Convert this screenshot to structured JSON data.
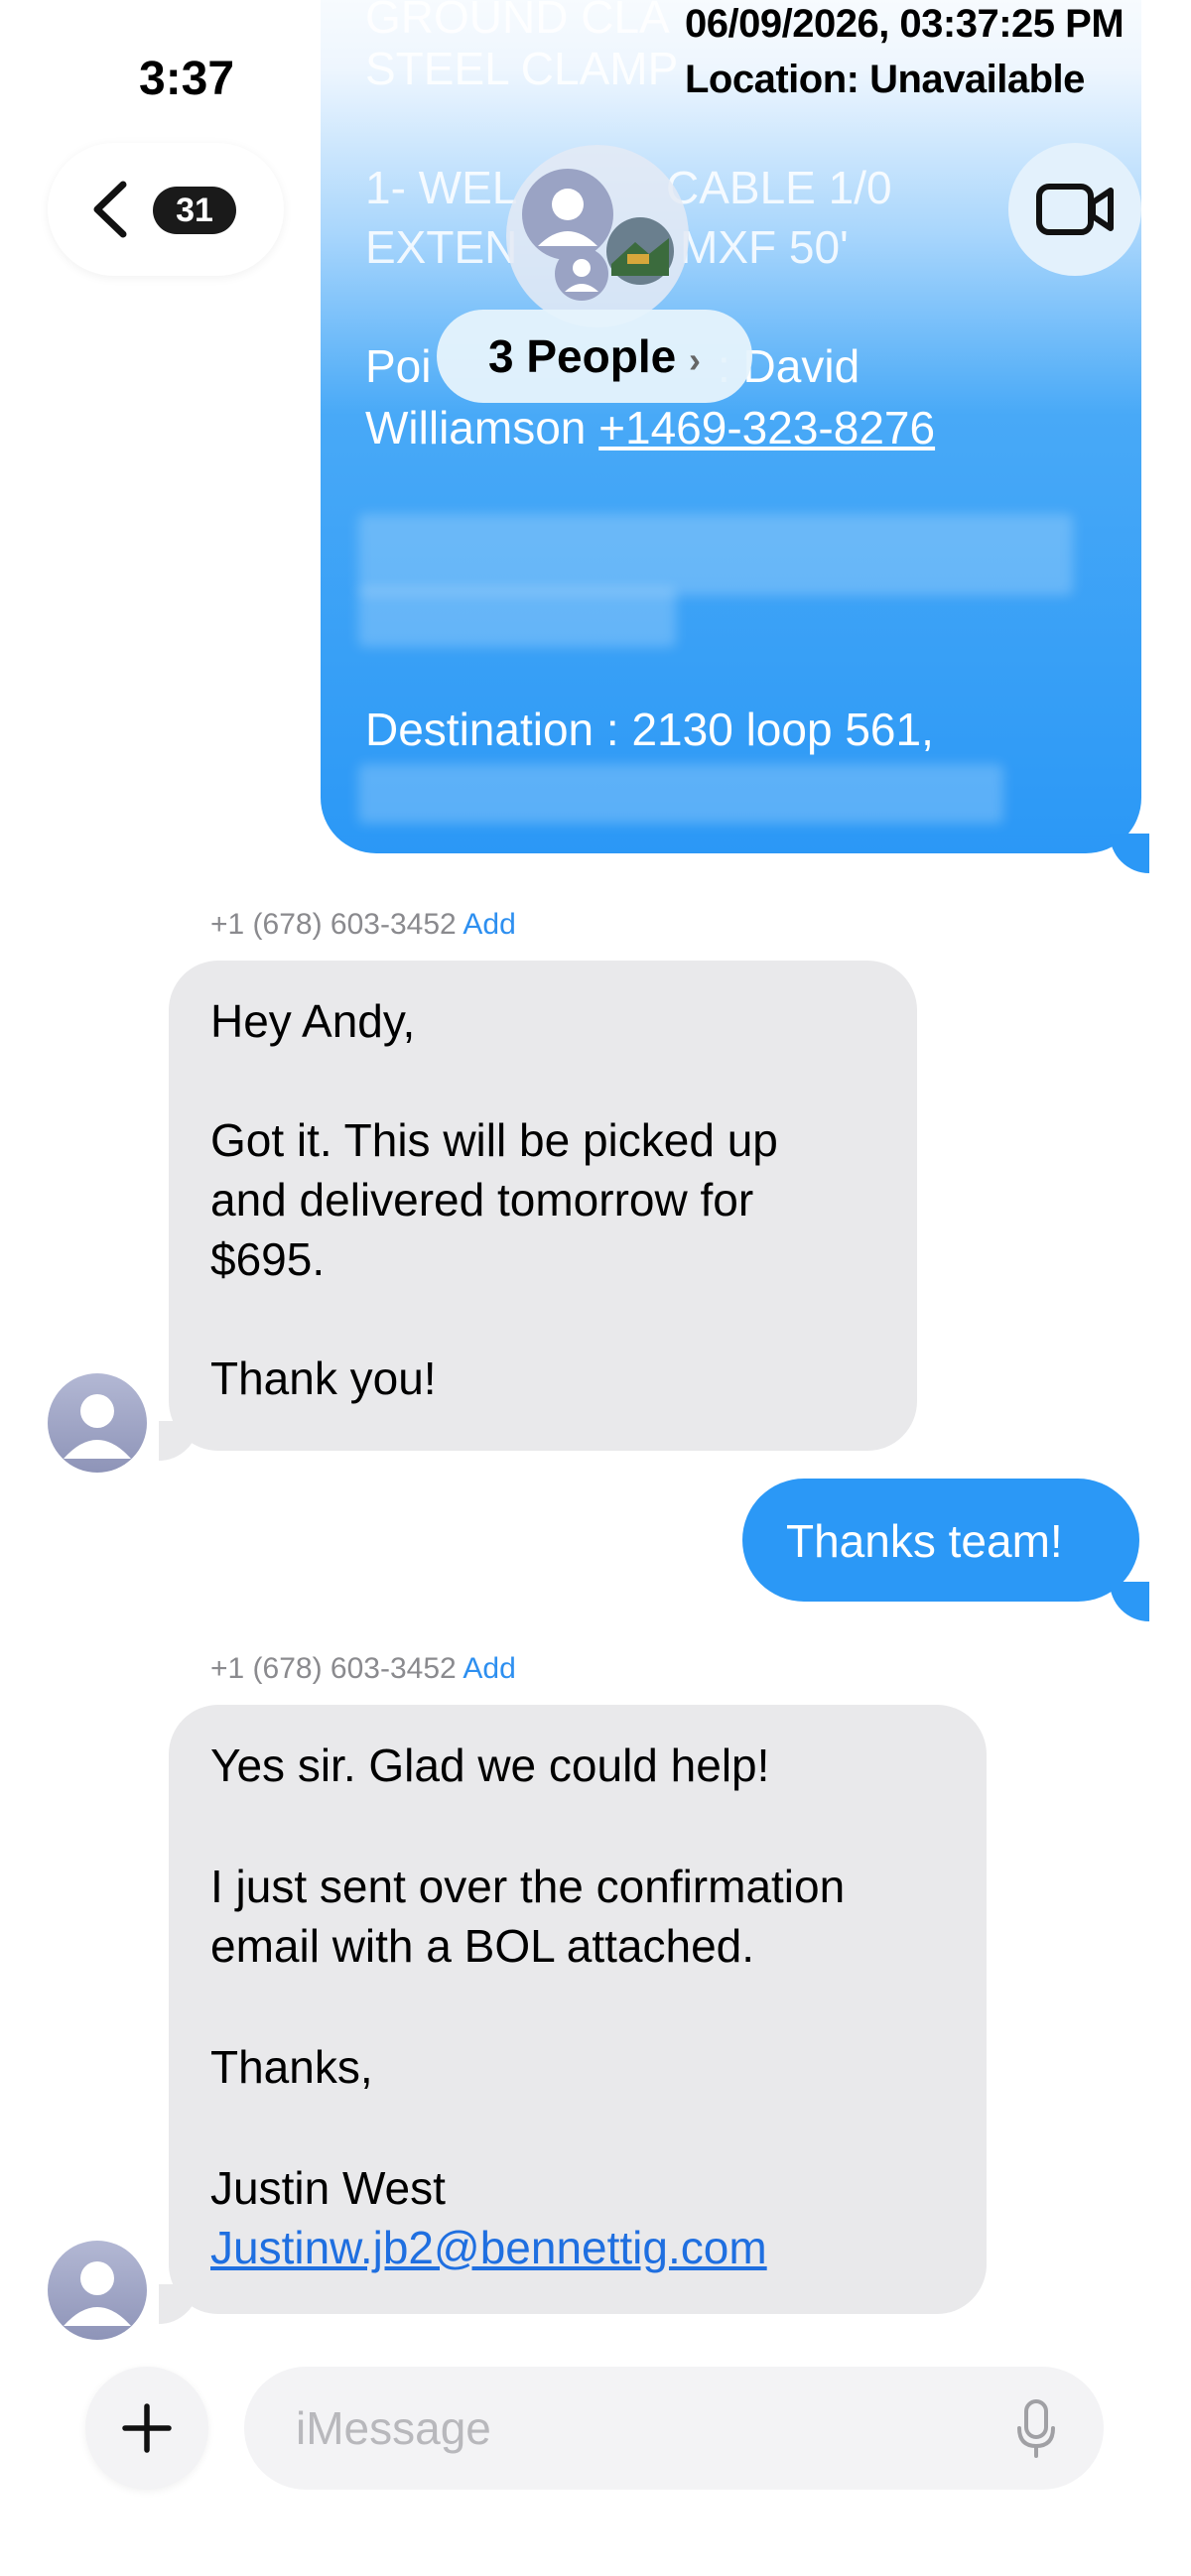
{
  "status_bar": {
    "time": "3:37",
    "timestamp": "06/09/2026, 03:37:25 PM",
    "location": "Location: Unavailable"
  },
  "nav": {
    "unread_count": "31",
    "group_label": "3 People"
  },
  "first_message": {
    "lines": [
      "GROUND CLA",
      "STEEL CLAMP",
      "1- WEL",
      "CABLE 1/0",
      "EXTEN",
      "MXF 50'",
      "Poi",
      ": David",
      "Williamson ",
      "+1469-323-8276",
      "Destination : 2130 loop 561,"
    ]
  },
  "messages": [
    {
      "sender": "+1 (678) 603-3452",
      "add_label": "Add",
      "lines": [
        "Hey Andy,",
        "Got it. This will be picked up",
        "and delivered tomorrow for",
        "$695.",
        "Thank you!"
      ]
    },
    {
      "text": "Thanks team!"
    },
    {
      "sender": "+1 (678) 603-3452",
      "add_label": "Add",
      "lines": [
        "Yes sir. Glad we could help!",
        "I just sent over the confirmation",
        "email with a BOL attached.",
        "Thanks,",
        "Justin West",
        "Justinw.jb2@bennettig.com"
      ]
    }
  ],
  "composer": {
    "placeholder": "iMessage"
  },
  "icons": {
    "back": "chevron-left-icon",
    "video": "video-camera-icon",
    "plus": "plus-icon",
    "mic": "microphone-icon",
    "avatar": "person-icon"
  },
  "colors": {
    "sent_bubble": "#2b98f6",
    "received_bubble": "#e9e9eb",
    "link": "#1f6fe0",
    "add_link": "#2d8ff0"
  }
}
